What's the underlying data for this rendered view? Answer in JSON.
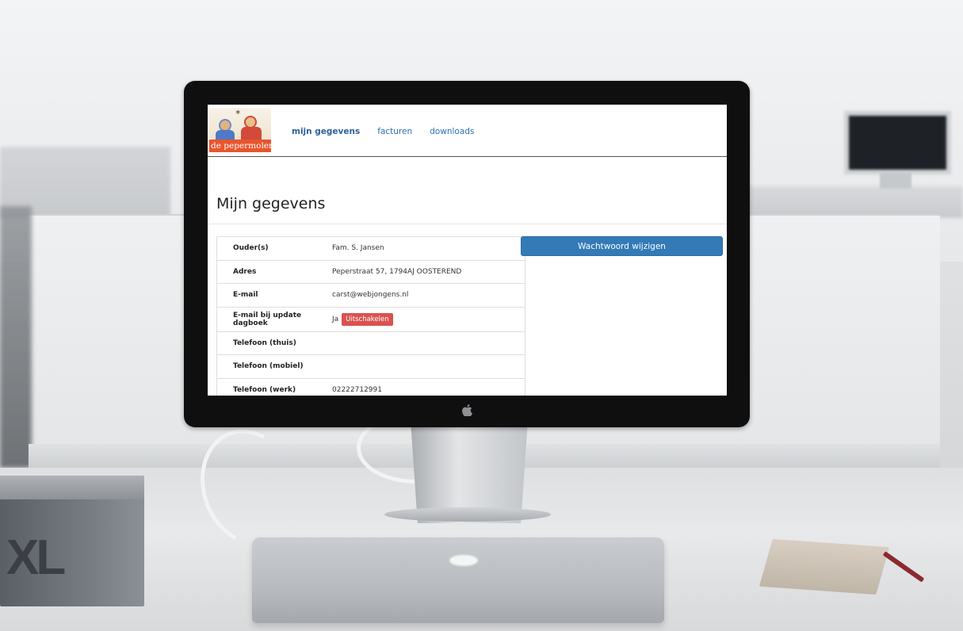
{
  "site": {
    "logo_text": "de pepermolen"
  },
  "nav": {
    "items": [
      {
        "label": "mijn gegevens",
        "active": true
      },
      {
        "label": "facturen",
        "active": false
      },
      {
        "label": "downloads",
        "active": false
      }
    ]
  },
  "page": {
    "title": "Mijn gegevens"
  },
  "details": {
    "rows": [
      {
        "label": "Ouder(s)",
        "value": "Fam. S. Jansen"
      },
      {
        "label": "Adres",
        "value": "Peperstraat 57, 1794AJ OOSTEREND"
      },
      {
        "label": "E-mail",
        "value": "carst@webjongens.nl"
      },
      {
        "label": "E-mail bij update dagboek",
        "value": "Ja",
        "action_label": "Uitschakelen"
      },
      {
        "label": "Telefoon (thuis)",
        "value": ""
      },
      {
        "label": "Telefoon (mobiel)",
        "value": ""
      },
      {
        "label": "Telefoon (werk)",
        "value": "02222712991"
      }
    ]
  },
  "actions": {
    "change_password_label": "Wachtwoord wijzigen"
  },
  "scene": {
    "book_text": "XL"
  },
  "colors": {
    "primary": "#337ab7",
    "danger": "#d9534f",
    "logo_orange": "#e8552d",
    "link": "#2c6fb3"
  }
}
